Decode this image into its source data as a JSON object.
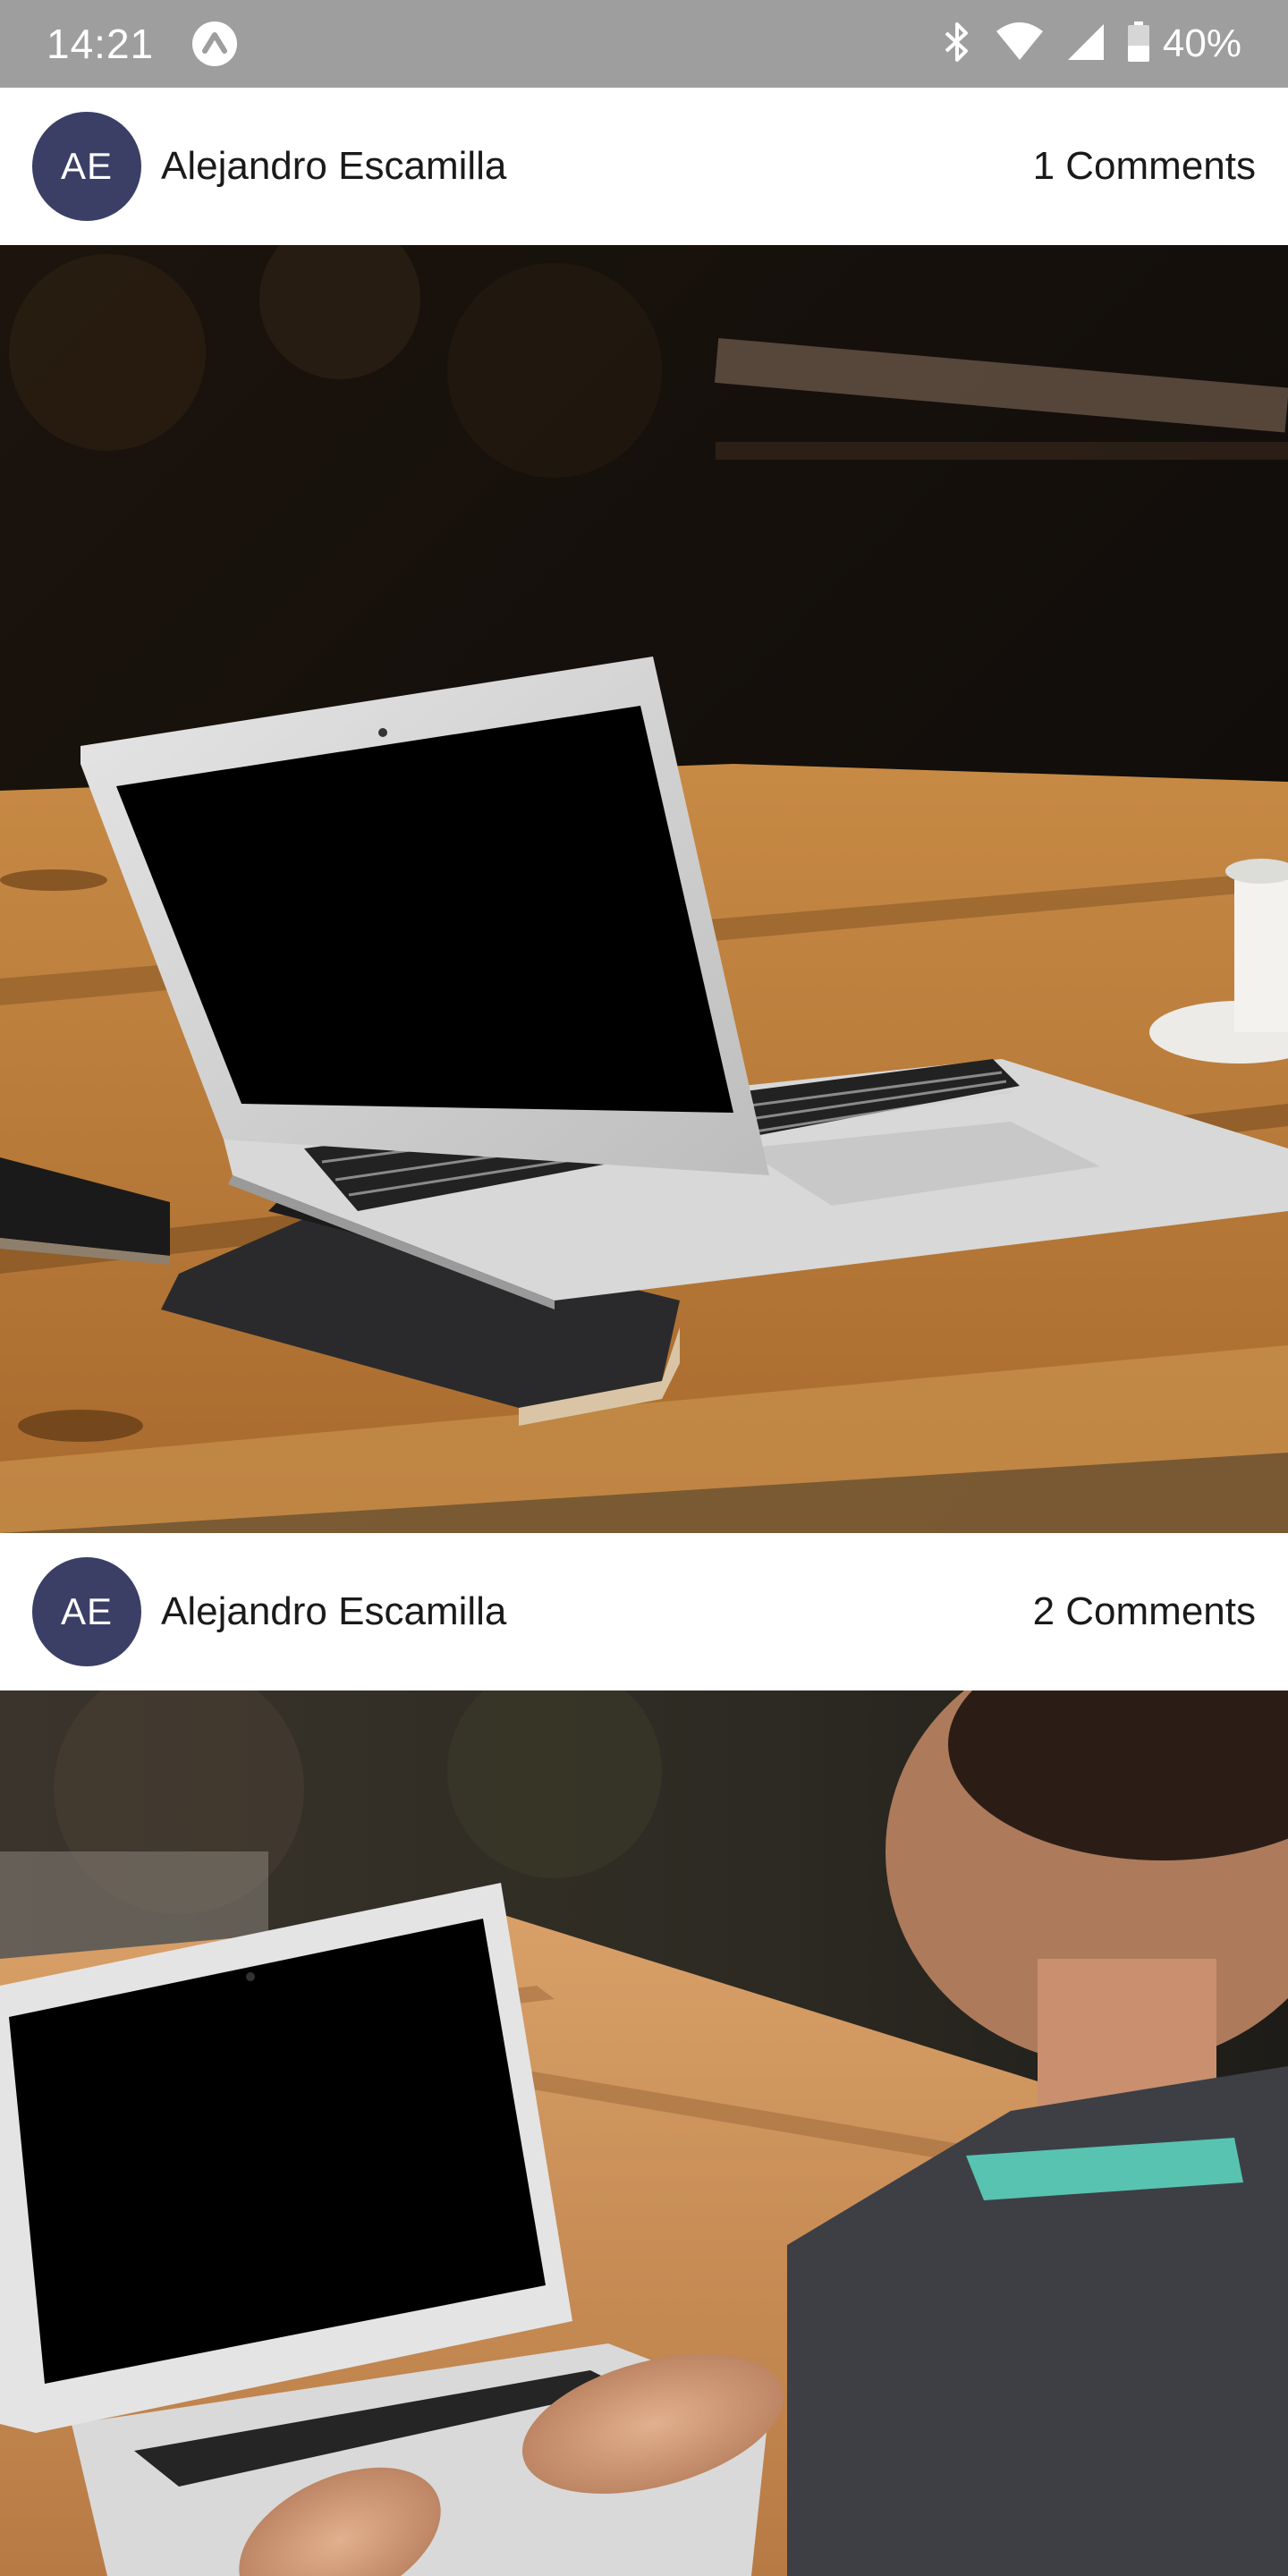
{
  "status_bar": {
    "time": "14:21",
    "battery": "40%",
    "icons": [
      "app-a-icon",
      "bluetooth-icon",
      "wifi-icon",
      "signal-icon",
      "battery-icon"
    ]
  },
  "posts": [
    {
      "avatar_initials": "AE",
      "author": "Alejandro Escamilla",
      "comments": "1 Comments",
      "image_name": "laptop-on-wooden-table-photo"
    },
    {
      "avatar_initials": "AE",
      "author": "Alejandro Escamilla",
      "comments": "2 Comments",
      "image_name": "person-typing-on-laptop-photo"
    }
  ],
  "colors": {
    "status_bar": "#9e9e9e",
    "avatar": "#3b3f66"
  }
}
